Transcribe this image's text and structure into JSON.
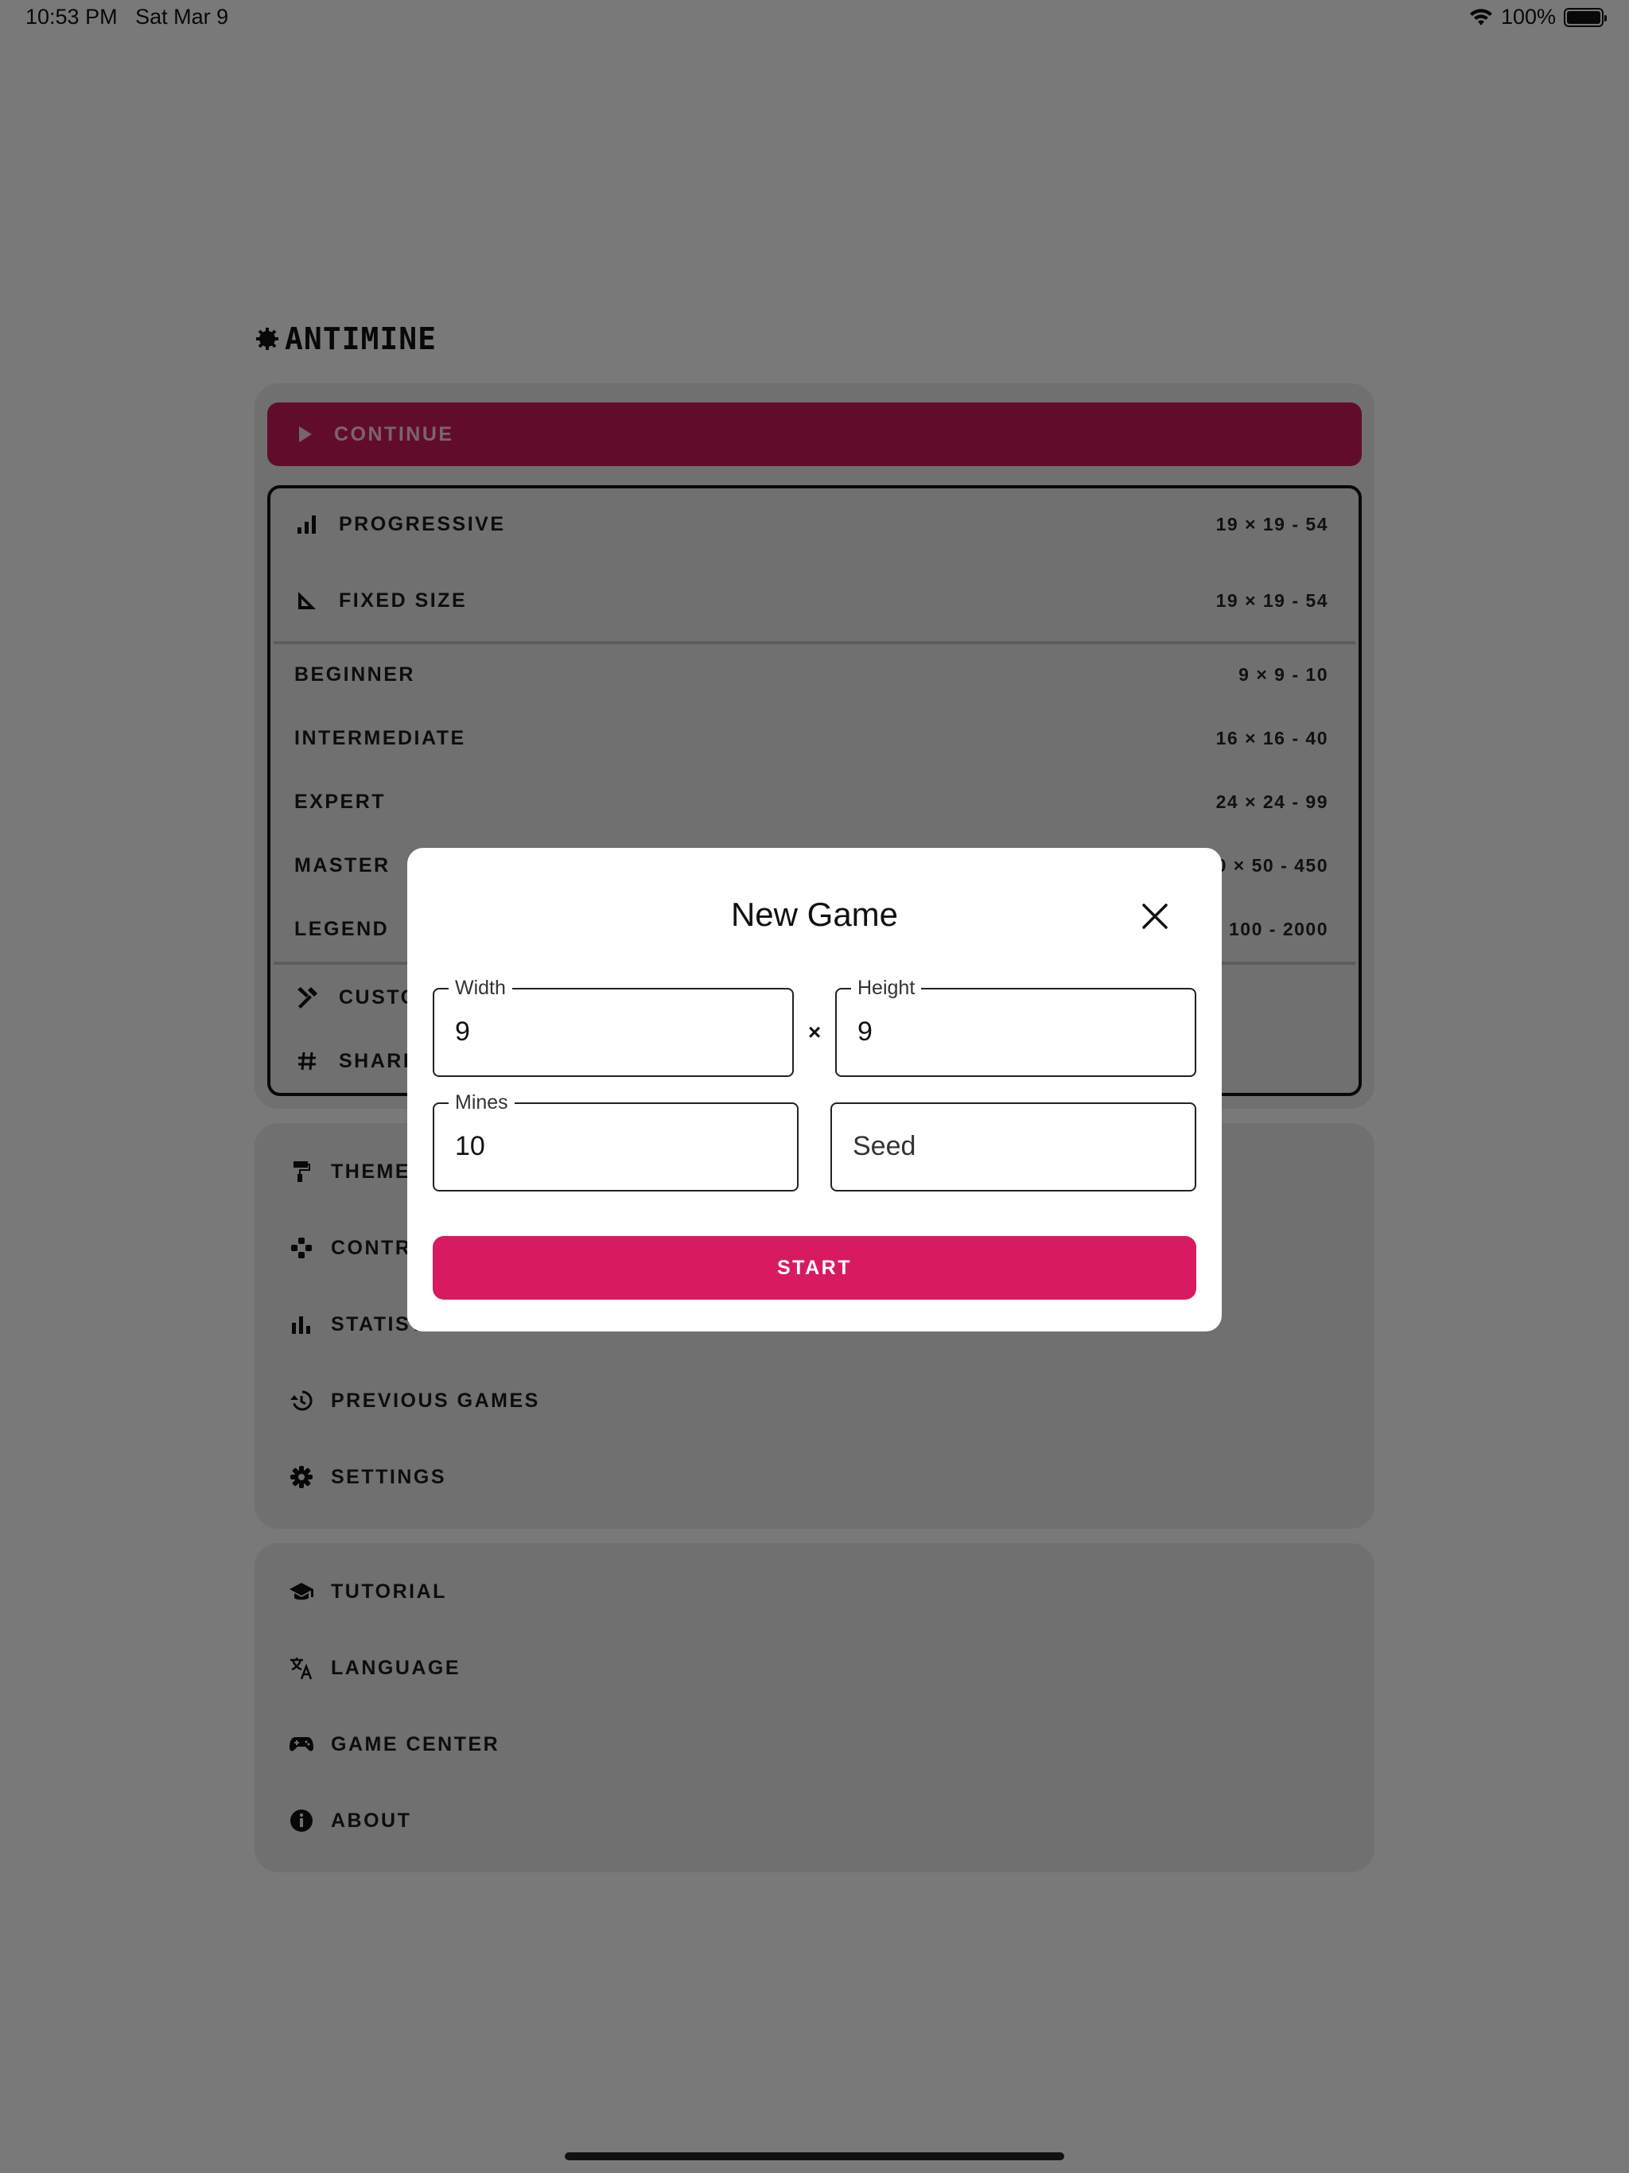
{
  "status_bar": {
    "time": "10:53 PM",
    "date": "Sat Mar 9",
    "battery": "100%"
  },
  "app": {
    "logo_text": "ANTIMINE"
  },
  "continue": {
    "label": "CONTINUE"
  },
  "modes": [
    {
      "label": "PROGRESSIVE",
      "meta": "19 × 19 - 54",
      "icon": "bar-chart-icon"
    },
    {
      "label": "FIXED SIZE",
      "meta": "19 × 19 - 54",
      "icon": "set-square-icon"
    }
  ],
  "difficulties": [
    {
      "label": "BEGINNER",
      "meta": "9 × 9 - 10"
    },
    {
      "label": "INTERMEDIATE",
      "meta": "16 × 16 - 40"
    },
    {
      "label": "EXPERT",
      "meta": "24 × 24 - 99"
    },
    {
      "label": "MASTER",
      "meta": "50 × 50 - 450"
    },
    {
      "label": "LEGEND",
      "meta": "100 × 100 - 2000"
    }
  ],
  "extras": [
    {
      "label": "CUSTOM",
      "icon": "tools-icon"
    },
    {
      "label": "SHARE",
      "icon": "hash-icon"
    }
  ],
  "menu_2": [
    {
      "label": "THEMES",
      "icon": "paint-roller-icon"
    },
    {
      "label": "CONTROLS",
      "icon": "gamepad-icon"
    },
    {
      "label": "STATISTICS",
      "icon": "bar-chart-icon"
    },
    {
      "label": "PREVIOUS GAMES",
      "icon": "history-icon"
    },
    {
      "label": "SETTINGS",
      "icon": "gear-icon"
    }
  ],
  "menu_3": [
    {
      "label": "TUTORIAL",
      "icon": "graduation-cap-icon"
    },
    {
      "label": "LANGUAGE",
      "icon": "translate-icon"
    },
    {
      "label": "GAME CENTER",
      "icon": "controller-icon"
    },
    {
      "label": "ABOUT",
      "icon": "info-icon"
    }
  ],
  "dialog": {
    "title": "New Game",
    "width_label": "Width",
    "width_value": "9",
    "height_label": "Height",
    "height_value": "9",
    "times_symbol": "×",
    "mines_label": "Mines",
    "mines_value": "10",
    "seed_placeholder": "Seed",
    "start_label": "START"
  },
  "colors": {
    "accent": "#d81b60",
    "background": "#f3f3f3",
    "card": "#e0e0e0"
  }
}
